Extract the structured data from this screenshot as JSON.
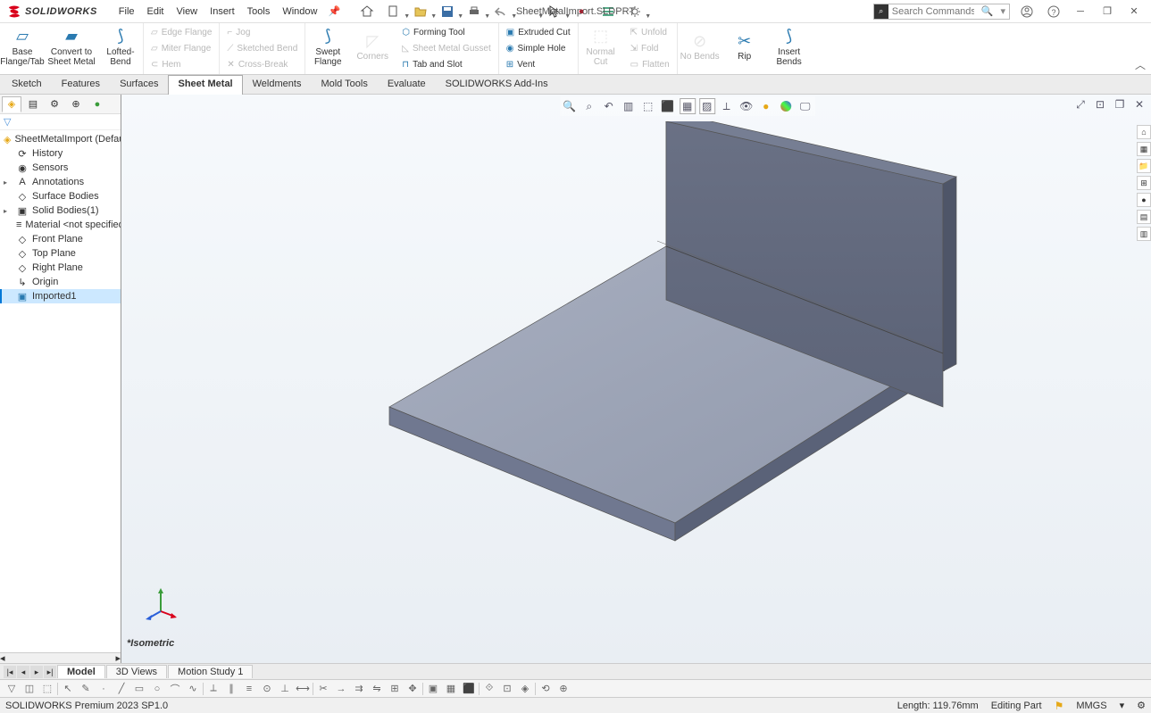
{
  "app": {
    "logo_text": "SOLIDWORKS",
    "doc_title": "SheetMetalImport.SLDPRT",
    "search_placeholder": "Search Commands"
  },
  "menu": [
    "File",
    "Edit",
    "View",
    "Insert",
    "Tools",
    "Window"
  ],
  "ribbon": {
    "base": "Base Flange/Tab",
    "convert": "Convert to Sheet Metal",
    "lofted": "Lofted-Bend",
    "edge": "Edge Flange",
    "miter": "Miter Flange",
    "hem": "Hem",
    "jog": "Jog",
    "sketched": "Sketched Bend",
    "cross": "Cross-Break",
    "swept": "Swept Flange",
    "corners": "Corners",
    "forming": "Forming Tool",
    "gusset": "Sheet Metal Gusset",
    "tabslot": "Tab and Slot",
    "extrudedcut": "Extruded Cut",
    "simplehole": "Simple Hole",
    "vent": "Vent",
    "normalcut": "Normal Cut",
    "unfold": "Unfold",
    "fold": "Fold",
    "flatten": "Flatten",
    "nobends": "No Bends",
    "rip": "Rip",
    "insertbends": "Insert Bends"
  },
  "cmdtabs": [
    "Sketch",
    "Features",
    "Surfaces",
    "Sheet Metal",
    "Weldments",
    "Mold Tools",
    "Evaluate",
    "SOLIDWORKS Add-Ins"
  ],
  "cmdtabs_active": 3,
  "tree": {
    "root": "SheetMetalImport (Default) <",
    "items": [
      {
        "icon": "⟳",
        "label": "History"
      },
      {
        "icon": "◉",
        "label": "Sensors"
      },
      {
        "icon": "A",
        "label": "Annotations",
        "expandable": true
      },
      {
        "icon": "◇",
        "label": "Surface Bodies"
      },
      {
        "icon": "▣",
        "label": "Solid Bodies(1)",
        "expandable": true
      },
      {
        "icon": "≡",
        "label": "Material <not specified>"
      },
      {
        "icon": "◇",
        "label": "Front Plane"
      },
      {
        "icon": "◇",
        "label": "Top Plane"
      },
      {
        "icon": "◇",
        "label": "Right Plane"
      },
      {
        "icon": "↳",
        "label": "Origin"
      },
      {
        "icon": "▣",
        "label": "Imported1",
        "selected": true
      }
    ]
  },
  "view_label": "*Isometric",
  "bottom_tabs": [
    "Model",
    "3D Views",
    "Motion Study 1"
  ],
  "bottom_tabs_active": 0,
  "status": {
    "left": "SOLIDWORKS Premium 2023 SP1.0",
    "length": "Length: 119.76mm",
    "mode": "Editing Part",
    "units": "MMGS"
  }
}
